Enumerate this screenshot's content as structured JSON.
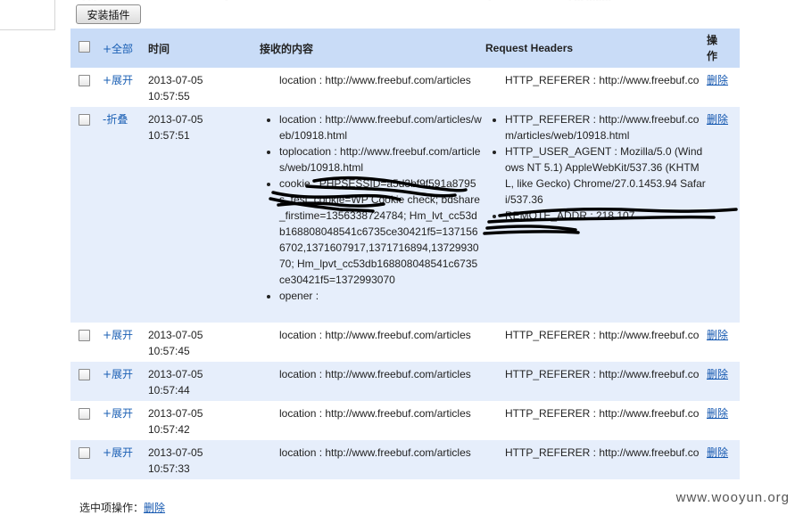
{
  "toolbar": {
    "install_label": "安装插件"
  },
  "table": {
    "headers": {
      "expand_all": "+全部",
      "time": "时间",
      "content": "接收的内容",
      "request_headers": "Request Headers",
      "action": "操作"
    },
    "rows": [
      {
        "toggle": "+展开",
        "date": "2013-07-05",
        "clock": "10:57:55",
        "content": [
          "location : http://www.freebuf.com/articles"
        ],
        "headers": [
          "HTTP_REFERER : http://www.freebuf.co"
        ],
        "action": "删除"
      },
      {
        "toggle": "-折叠",
        "date": "2013-07-05",
        "clock": "10:57:51",
        "content": [
          "location : http://www.freebuf.com/articles/web/10918.html",
          "toplocation : http://www.freebuf.com/articles/web/10918.html",
          "cookie : PHPSESSID=a5d3bf9f591a8795                  s_test_cookie=WP Cookie check; bdshare_firstime=1356338724784; Hm_lvt_cc53db168808048541c6735ce30421f5=1371566702,1371607917,1371716894,1372993070; Hm_lpvt_cc53db168808048541c6735ce30421f5=1372993070",
          "opener :"
        ],
        "headers": [
          "HTTP_REFERER : http://www.freebuf.com/articles/web/10918.html",
          "HTTP_USER_AGENT : Mozilla/5.0 (Windows NT 5.1) AppleWebKit/537.36 (KHTML, like Gecko) Chrome/27.0.1453.94 Safari/537.36",
          "REMOTE_ADDR :                         218.107"
        ],
        "action": "删除"
      },
      {
        "toggle": "+展开",
        "date": "2013-07-05",
        "clock": "10:57:45",
        "content": [
          "location : http://www.freebuf.com/articles"
        ],
        "headers": [
          "HTTP_REFERER : http://www.freebuf.co"
        ],
        "action": "删除"
      },
      {
        "toggle": "+展开",
        "date": "2013-07-05",
        "clock": "10:57:44",
        "content": [
          "location : http://www.freebuf.com/articles"
        ],
        "headers": [
          "HTTP_REFERER : http://www.freebuf.co"
        ],
        "action": "删除"
      },
      {
        "toggle": "+展开",
        "date": "2013-07-05",
        "clock": "10:57:42",
        "content": [
          "location : http://www.freebuf.com/articles"
        ],
        "headers": [
          "HTTP_REFERER : http://www.freebuf.co"
        ],
        "action": "删除"
      },
      {
        "toggle": "+展开",
        "date": "2013-07-05",
        "clock": "10:57:33",
        "content": [
          "location : http://www.freebuf.com/articles"
        ],
        "headers": [
          "HTTP_REFERER : http://www.freebuf.co"
        ],
        "action": "删除"
      }
    ]
  },
  "footer": {
    "selected_ops_label": "选中项操作：",
    "delete_link": "删除"
  },
  "watermark": "www.wooyun.org",
  "colors": {
    "header_bg": "#c9dcf7",
    "alt_row_bg": "#e6eefb",
    "link": "#1558b0"
  }
}
